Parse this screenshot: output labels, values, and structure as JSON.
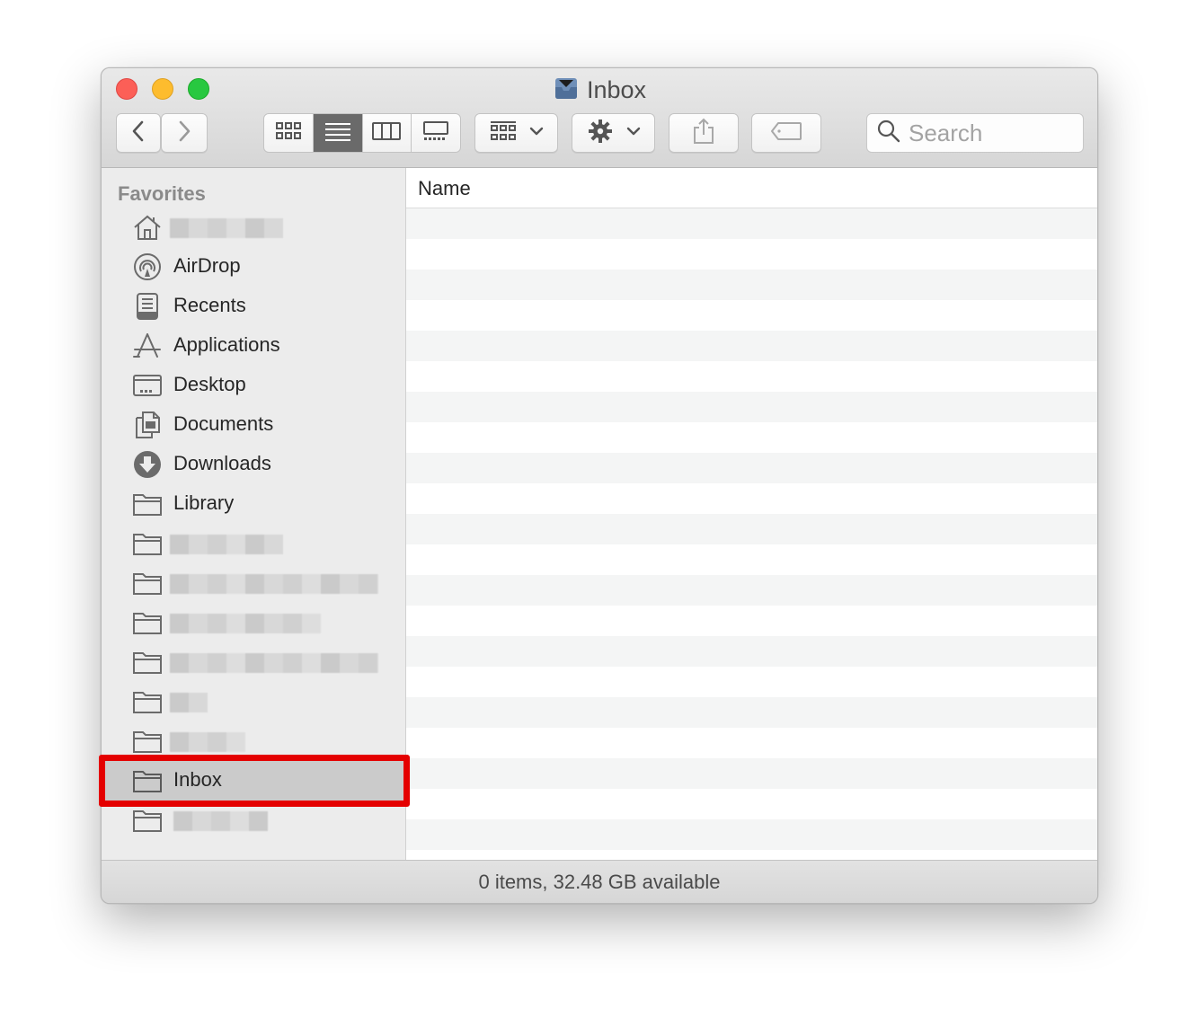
{
  "window": {
    "title": "Inbox"
  },
  "toolbar": {
    "back_icon": "chevron-left-icon",
    "forward_icon": "chevron-right-icon",
    "view_modes": [
      "icon-view",
      "list-view",
      "column-view",
      "gallery-view"
    ],
    "active_view": "list-view",
    "search_placeholder": "Search"
  },
  "sidebar": {
    "section_title": "Favorites",
    "items": [
      {
        "label": "",
        "icon": "home-icon",
        "redacted": true
      },
      {
        "label": "AirDrop",
        "icon": "airdrop-icon"
      },
      {
        "label": "Recents",
        "icon": "recents-icon"
      },
      {
        "label": "Applications",
        "icon": "applications-icon"
      },
      {
        "label": "Desktop",
        "icon": "desktop-icon"
      },
      {
        "label": "Documents",
        "icon": "documents-icon"
      },
      {
        "label": "Downloads",
        "icon": "downloads-icon"
      },
      {
        "label": "Library",
        "icon": "folder-icon"
      },
      {
        "label": "",
        "icon": "folder-icon",
        "redacted": true
      },
      {
        "label": "",
        "icon": "folder-icon",
        "redacted": true
      },
      {
        "label": "",
        "icon": "folder-icon",
        "redacted": true
      },
      {
        "label": "",
        "icon": "folder-icon",
        "redacted": true
      },
      {
        "label": "",
        "icon": "folder-icon",
        "redacted": true
      },
      {
        "label": "",
        "icon": "folder-icon",
        "redacted": true
      },
      {
        "label": "Inbox",
        "icon": "folder-icon",
        "selected": true
      },
      {
        "label": "",
        "icon": "folder-icon",
        "redacted": true
      }
    ]
  },
  "content": {
    "column_name": "Name"
  },
  "statusbar": {
    "text": "0 items, 32.48 GB available"
  },
  "colors": {
    "highlight": "#e40000",
    "close": "#fc5f57",
    "minimize": "#fdbc2e",
    "zoom": "#28c840"
  }
}
